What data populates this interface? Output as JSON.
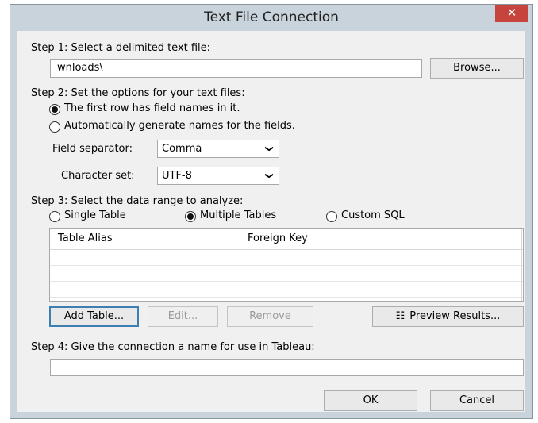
{
  "window": {
    "title": "Text File Connection",
    "close_glyph": "✕"
  },
  "step1": {
    "label": "Step 1: Select a delimited text file:",
    "path_value": "wnloads\\",
    "browse_label": "Browse..."
  },
  "step2": {
    "label": "Step 2: Set the options for your text files:",
    "radio_first_row": "The first row has field names in it.",
    "radio_auto": "Automatically generate names for the fields.",
    "field_separator_label": "Field separator:",
    "field_separator_value": "Comma",
    "charset_label": "Character set:",
    "charset_value": "UTF-8",
    "chevron": "❯"
  },
  "step3": {
    "label": "Step 3: Select the data range to analyze:",
    "radio_single": "Single Table",
    "radio_multiple": "Multiple Tables",
    "radio_custom": "Custom SQL",
    "columns": [
      "Table Alias",
      "Foreign Key"
    ],
    "add_table_label": "Add Table...",
    "edit_label": "Edit...",
    "remove_label": "Remove",
    "preview_label": "Preview Results...",
    "preview_icon": "☷"
  },
  "step4": {
    "label": "Step 4: Give the connection a name for use in Tableau:",
    "name_value": ""
  },
  "footer": {
    "ok_label": "OK",
    "cancel_label": "Cancel"
  },
  "colors": {
    "close_red": "#c7443c",
    "frame": "#c9d3db",
    "client": "#f0f0f0"
  }
}
